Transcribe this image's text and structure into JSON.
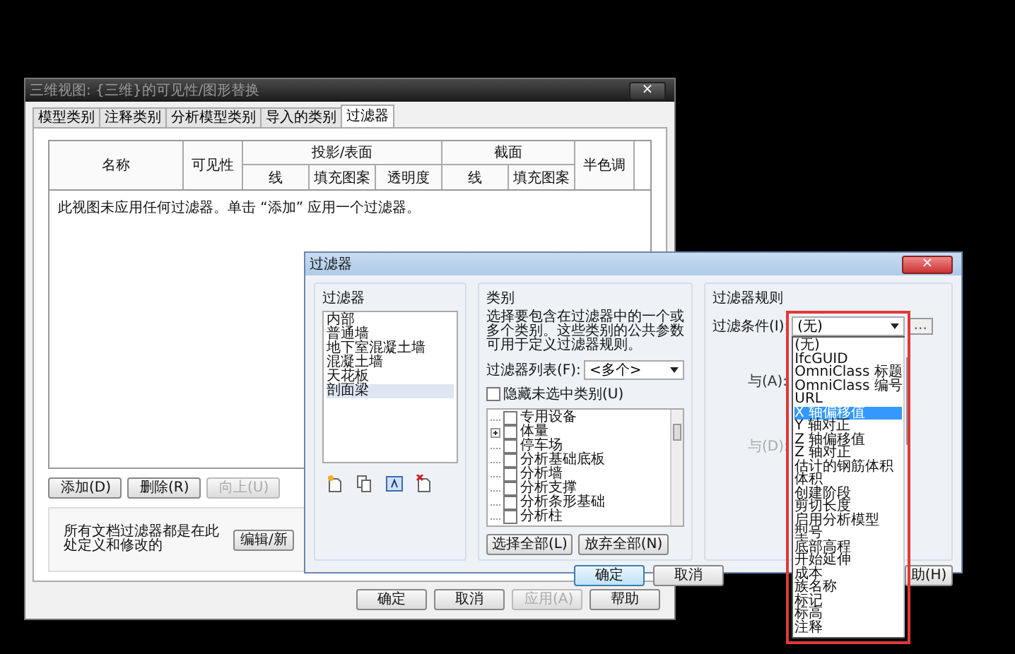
{
  "main_dialog": {
    "title": "三维视图: {三维}的可见性/图形替换",
    "close": "×",
    "tabs": [
      {
        "label": "模型类别",
        "selected": false
      },
      {
        "label": "注释类别",
        "selected": false
      },
      {
        "label": "分析模型类别",
        "selected": false
      },
      {
        "label": "导入的类别",
        "selected": false
      },
      {
        "label": "过滤器",
        "selected": true
      }
    ],
    "table": {
      "columns": [
        {
          "label": "名称"
        },
        {
          "label": "可见性"
        },
        {
          "label": "投影/表面",
          "children": [
            "线",
            "填充图案",
            "透明度"
          ]
        },
        {
          "label": "截面",
          "children": [
            "线",
            "填充图案"
          ]
        },
        {
          "label": "半色调"
        }
      ],
      "empty_message": "此视图未应用任何过滤器。单击 “添加” 应用一个过滤器。"
    },
    "row_buttons": [
      {
        "label": "添加(D)",
        "disabled": false
      },
      {
        "label": "删除(R)",
        "disabled": false
      },
      {
        "label": "向上(U)",
        "disabled": true
      }
    ],
    "note": "所有文档过滤器都是在此处定义和修改的",
    "edit_button": "编辑/新",
    "buttons": [
      {
        "label": "确定",
        "disabled": false
      },
      {
        "label": "取消",
        "disabled": false
      },
      {
        "label": "应用(A)",
        "disabled": true
      },
      {
        "label": "帮助",
        "disabled": false
      }
    ]
  },
  "filter_dialog": {
    "title": "过滤器",
    "close": "×",
    "filters": {
      "heading": "过滤器",
      "items": [
        {
          "label": "内部",
          "selected": false
        },
        {
          "label": "普通墙",
          "selected": false
        },
        {
          "label": "地下室混凝土墙",
          "selected": false
        },
        {
          "label": "混凝土墙",
          "selected": false
        },
        {
          "label": "天花板",
          "selected": false
        },
        {
          "label": "剖面梁",
          "selected": true
        }
      ]
    },
    "categories": {
      "heading": "类别",
      "description": "选择要包含在过滤器中的一个或多个类别。这些类别的公共参数可用于定义过滤器规则。",
      "list_label": "过滤器列表(F):",
      "list_value": "<多个>",
      "hide_unchecked": {
        "label": "隐藏未选中类别(U)",
        "checked": false
      },
      "items": [
        {
          "label": "专用设备",
          "checked": false,
          "expandable": false
        },
        {
          "label": "体量",
          "checked": false,
          "expandable": true
        },
        {
          "label": "停车场",
          "checked": false,
          "expandable": false
        },
        {
          "label": "分析基础底板",
          "checked": false,
          "expandable": false
        },
        {
          "label": "分析墙",
          "checked": false,
          "expandable": false
        },
        {
          "label": "分析支撑",
          "checked": false,
          "expandable": false
        },
        {
          "label": "分析条形基础",
          "checked": false,
          "expandable": false
        },
        {
          "label": "分析柱",
          "checked": false,
          "expandable": false
        }
      ],
      "select_all": "选择全部(L)",
      "clear_all": "放弃全部(N)"
    },
    "rules": {
      "heading": "过滤器规则",
      "condition_label": "过滤条件(I):",
      "condition_value": "(无)",
      "more": "...",
      "and_labels": [
        "与(A):",
        "与(D):"
      ],
      "options": [
        {
          "label": "(无)",
          "selected": false
        },
        {
          "label": "IfcGUID",
          "selected": false
        },
        {
          "label": "OmniClass 标题",
          "selected": false
        },
        {
          "label": "OmniClass 编号",
          "selected": false
        },
        {
          "label": "URL",
          "selected": false
        },
        {
          "label": "X 轴偏移值",
          "selected": true
        },
        {
          "label": "Y 轴对正",
          "selected": false
        },
        {
          "label": "Z 轴偏移值",
          "selected": false
        },
        {
          "label": "Z 轴对正",
          "selected": false
        },
        {
          "label": "估计的钢筋体积",
          "selected": false
        },
        {
          "label": "体积",
          "selected": false
        },
        {
          "label": "创建阶段",
          "selected": false
        },
        {
          "label": "剪切长度",
          "selected": false
        },
        {
          "label": "启用分析模型",
          "selected": false
        },
        {
          "label": "型号",
          "selected": false
        },
        {
          "label": "底部高程",
          "selected": false
        },
        {
          "label": "开始延伸",
          "selected": false
        },
        {
          "label": "成本",
          "selected": false
        },
        {
          "label": "族名称",
          "selected": false
        },
        {
          "label": "标记",
          "selected": false
        },
        {
          "label": "标高",
          "selected": false
        },
        {
          "label": "注释",
          "selected": false
        }
      ]
    },
    "buttons": [
      {
        "label": "确定",
        "default": true
      },
      {
        "label": "取消",
        "default": false
      },
      {
        "label": "助(H)",
        "default": false
      }
    ]
  }
}
